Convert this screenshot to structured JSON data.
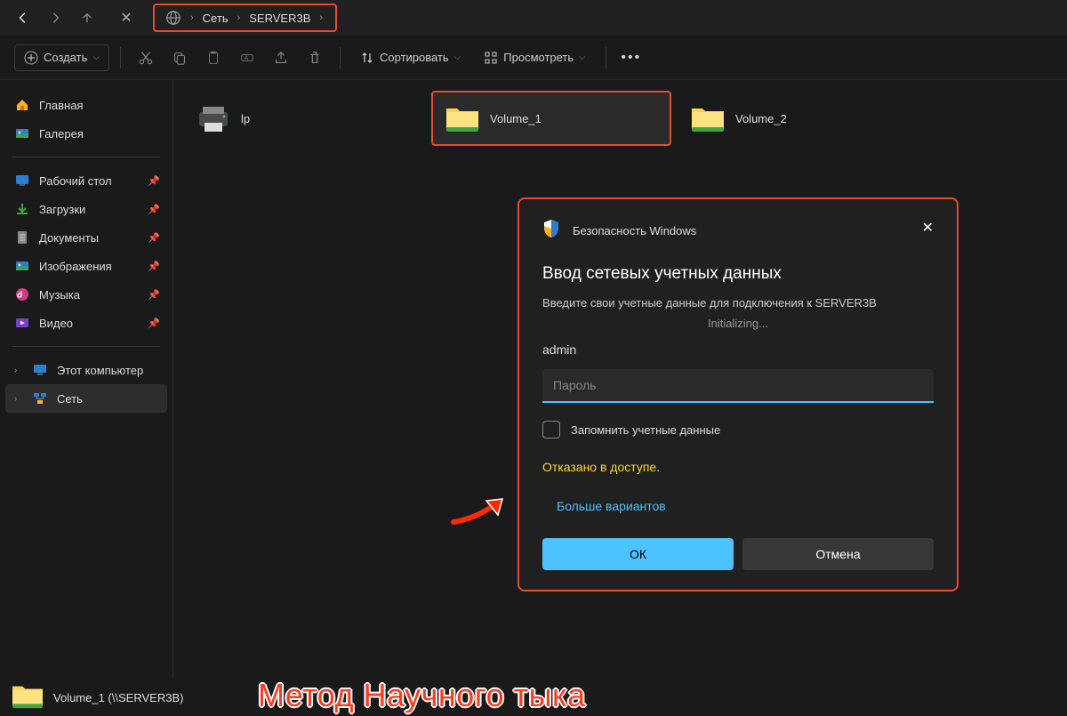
{
  "breadcrumb": {
    "items": [
      "Сеть",
      "SERVER3B"
    ]
  },
  "toolbar": {
    "create": "Создать",
    "sort": "Сортировать",
    "view": "Просмотреть"
  },
  "sidebar": {
    "home": "Главная",
    "gallery": "Галерея",
    "desktop": "Рабочий стол",
    "downloads": "Загрузки",
    "documents": "Документы",
    "pictures": "Изображения",
    "music": "Музыка",
    "videos": "Видео",
    "thispc": "Этот компьютер",
    "network": "Сеть"
  },
  "content": {
    "items": [
      {
        "name": "lp",
        "type": "printer"
      },
      {
        "name": "Volume_1",
        "type": "share"
      },
      {
        "name": "Volume_2",
        "type": "share"
      }
    ]
  },
  "dialog": {
    "security_title": "Безопасность Windows",
    "title": "Ввод сетевых учетных данных",
    "subtitle": "Введите свои учетные данные для подключения к SERVER3B",
    "initializing": "Initializing...",
    "username": "admin",
    "password_placeholder": "Пароль",
    "remember": "Запомнить учетные данные",
    "error": "Отказано в доступе.",
    "more_options": "Больше вариантов",
    "ok": "ОК",
    "cancel": "Отмена"
  },
  "taskbar": {
    "item": "Volume_1 (\\\\SERVER3B)"
  },
  "watermark": "Метод Научного тыка"
}
